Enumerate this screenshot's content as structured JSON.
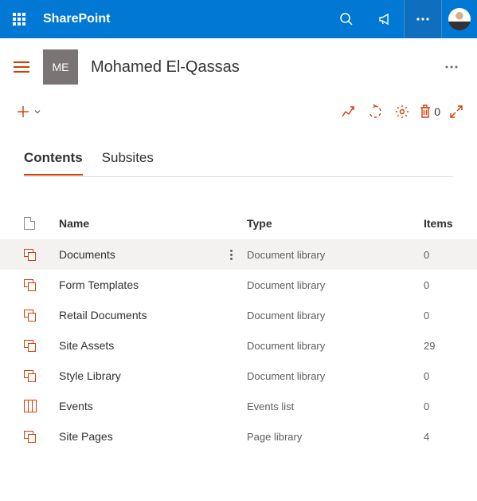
{
  "banner": {
    "brand": "SharePoint"
  },
  "site": {
    "logo_initials": "ME",
    "title": "Mohamed El-Qassas"
  },
  "commands": {
    "delete_count": "0"
  },
  "tabs": {
    "contents": "Contents",
    "subsites": "Subsites"
  },
  "columns": {
    "name": "Name",
    "type": "Type",
    "items": "Items"
  },
  "rows": [
    {
      "name": "Documents",
      "type": "Document library",
      "items": "0",
      "icon": "lib",
      "hover": true
    },
    {
      "name": "Form Templates",
      "type": "Document library",
      "items": "0",
      "icon": "lib"
    },
    {
      "name": "Retail Documents",
      "type": "Document library",
      "items": "0",
      "icon": "lib"
    },
    {
      "name": "Site Assets",
      "type": "Document library",
      "items": "29",
      "icon": "lib"
    },
    {
      "name": "Style Library",
      "type": "Document library",
      "items": "0",
      "icon": "lib"
    },
    {
      "name": "Events",
      "type": "Events list",
      "items": "0",
      "icon": "list"
    },
    {
      "name": "Site Pages",
      "type": "Page library",
      "items": "4",
      "icon": "lib"
    }
  ]
}
